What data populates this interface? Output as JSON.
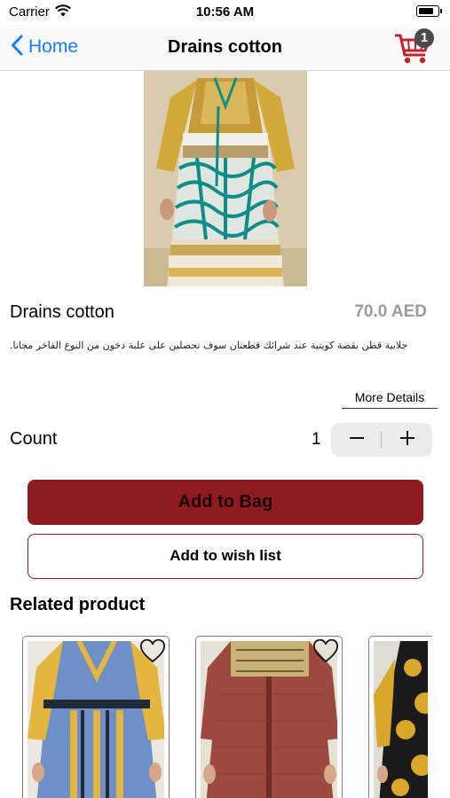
{
  "status_bar": {
    "carrier": "Carrier",
    "time": "10:56 AM",
    "battery_level": 0.85
  },
  "nav": {
    "back_label": "Home",
    "title": "Drains cotton",
    "cart_count": "1"
  },
  "product": {
    "name": "Drains cotton",
    "price": "70.0 AED",
    "description": "جلابية قطن بقصة كويتية عند شرائك قطعتان سوف تحصلين على علبة دخون من النوع الفاخر مجانا.",
    "more_details_label": "More Details"
  },
  "quantity": {
    "label": "Count",
    "value": "1"
  },
  "actions": {
    "add_to_bag": "Add to Bag",
    "add_to_wishlist": "Add to wish list"
  },
  "related": {
    "title": "Related product"
  },
  "colors": {
    "accent": "#8d1b1f",
    "link": "#1a7cf2",
    "price": "#9b9b9b",
    "teal": "#0f8c86"
  }
}
